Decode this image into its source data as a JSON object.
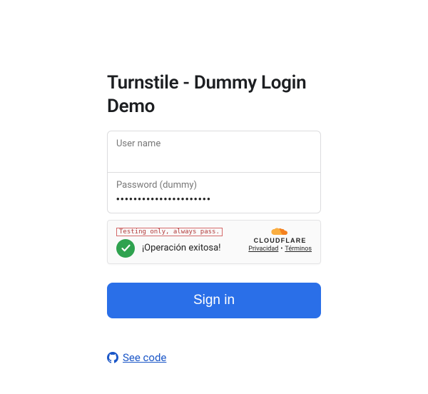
{
  "title": "Turnstile - Dummy Login Demo",
  "fields": {
    "username": {
      "label": "User name",
      "value": ""
    },
    "password": {
      "label": "Password (dummy)",
      "value": "••••••••••••••••••••••"
    }
  },
  "captcha": {
    "badge": "Testing only, always pass.",
    "message": "¡Operación exitosa!",
    "provider": "CLOUDFLARE",
    "links": {
      "privacy": "Privacidad",
      "terms": "Términos"
    }
  },
  "signin_label": "Sign in",
  "see_code_label": "See code",
  "colors": {
    "primary_button": "#2a6fe8",
    "success_check": "#2fa24f",
    "link": "#1a56c7"
  }
}
